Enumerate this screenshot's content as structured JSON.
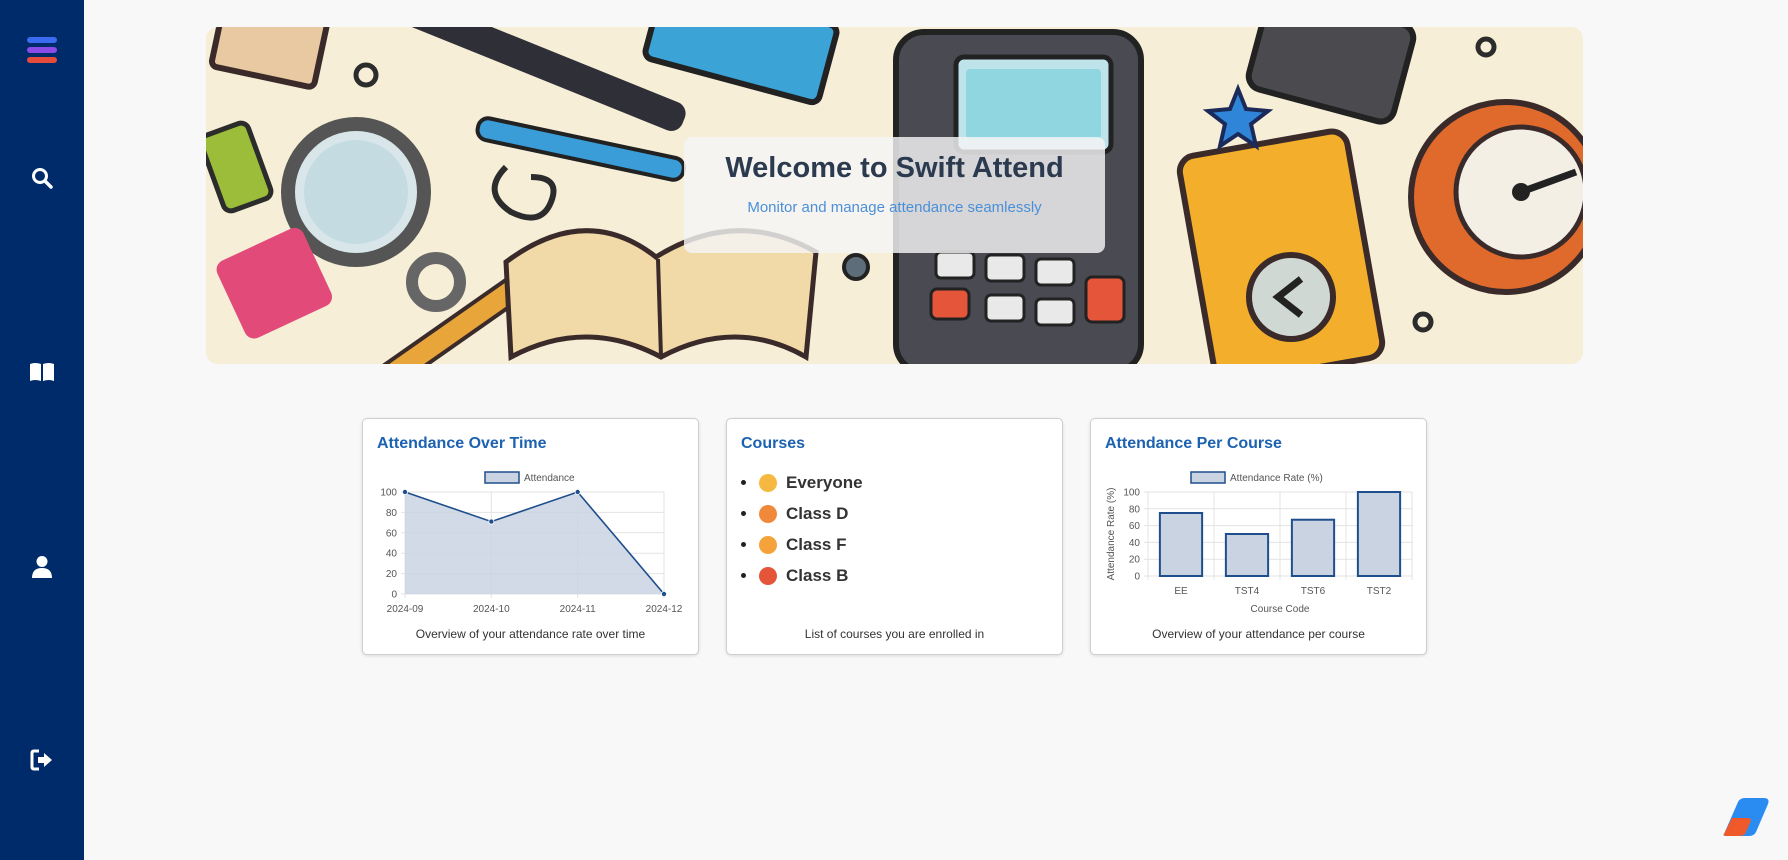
{
  "sidebar": {
    "items": [
      {
        "name": "menu",
        "icon": "menu-icon"
      },
      {
        "name": "search",
        "icon": "search-icon"
      },
      {
        "name": "courses",
        "icon": "book-icon"
      },
      {
        "name": "profile",
        "icon": "user-icon"
      },
      {
        "name": "logout",
        "icon": "logout-icon"
      }
    ]
  },
  "hero": {
    "title": "Welcome to Swift Attend",
    "subtitle": "Monitor and manage attendance seamlessly"
  },
  "cards": {
    "attendance_over_time": {
      "title": "Attendance Over Time",
      "footer": "Overview of your attendance rate over time"
    },
    "courses": {
      "title": "Courses",
      "footer": "List of courses you are enrolled in",
      "items": [
        {
          "label": "Everyone",
          "emoji_color": "#f5b942"
        },
        {
          "label": "Class D",
          "emoji_color": "#f08a3a"
        },
        {
          "label": "Class F",
          "emoji_color": "#f5a23a"
        },
        {
          "label": "Class B",
          "emoji_color": "#e5553a"
        }
      ]
    },
    "attendance_per_course": {
      "title": "Attendance Per Course",
      "footer": "Overview of your attendance per course"
    }
  },
  "colors": {
    "sidebar": "#002b6b",
    "accent": "#1c62b0",
    "series_line": "#1f4e8c",
    "series_fill": "#c9d3e2"
  },
  "chart_data": [
    {
      "type": "area",
      "title": "",
      "legend": [
        "Attendance"
      ],
      "x": [
        "2024-09",
        "2024-10",
        "2024-11",
        "2024-12"
      ],
      "series": [
        {
          "name": "Attendance",
          "values": [
            100,
            71,
            100,
            0
          ]
        }
      ],
      "ylim": [
        0,
        100
      ],
      "yticks": [
        0,
        20,
        40,
        60,
        80,
        100
      ],
      "xlabel": "",
      "ylabel": "",
      "grid": true,
      "legend_position": "top"
    },
    {
      "type": "bar",
      "title": "",
      "legend": [
        "Attendance Rate (%)"
      ],
      "categories": [
        "EE",
        "TST4",
        "TST6",
        "TST2"
      ],
      "series": [
        {
          "name": "Attendance Rate (%)",
          "values": [
            75,
            50,
            67,
            100
          ]
        }
      ],
      "ylim": [
        0,
        100
      ],
      "yticks": [
        0,
        20,
        40,
        60,
        80,
        100
      ],
      "xlabel": "Course Code",
      "ylabel": "Attendance Rate (%)",
      "grid": true,
      "legend_position": "top"
    }
  ]
}
